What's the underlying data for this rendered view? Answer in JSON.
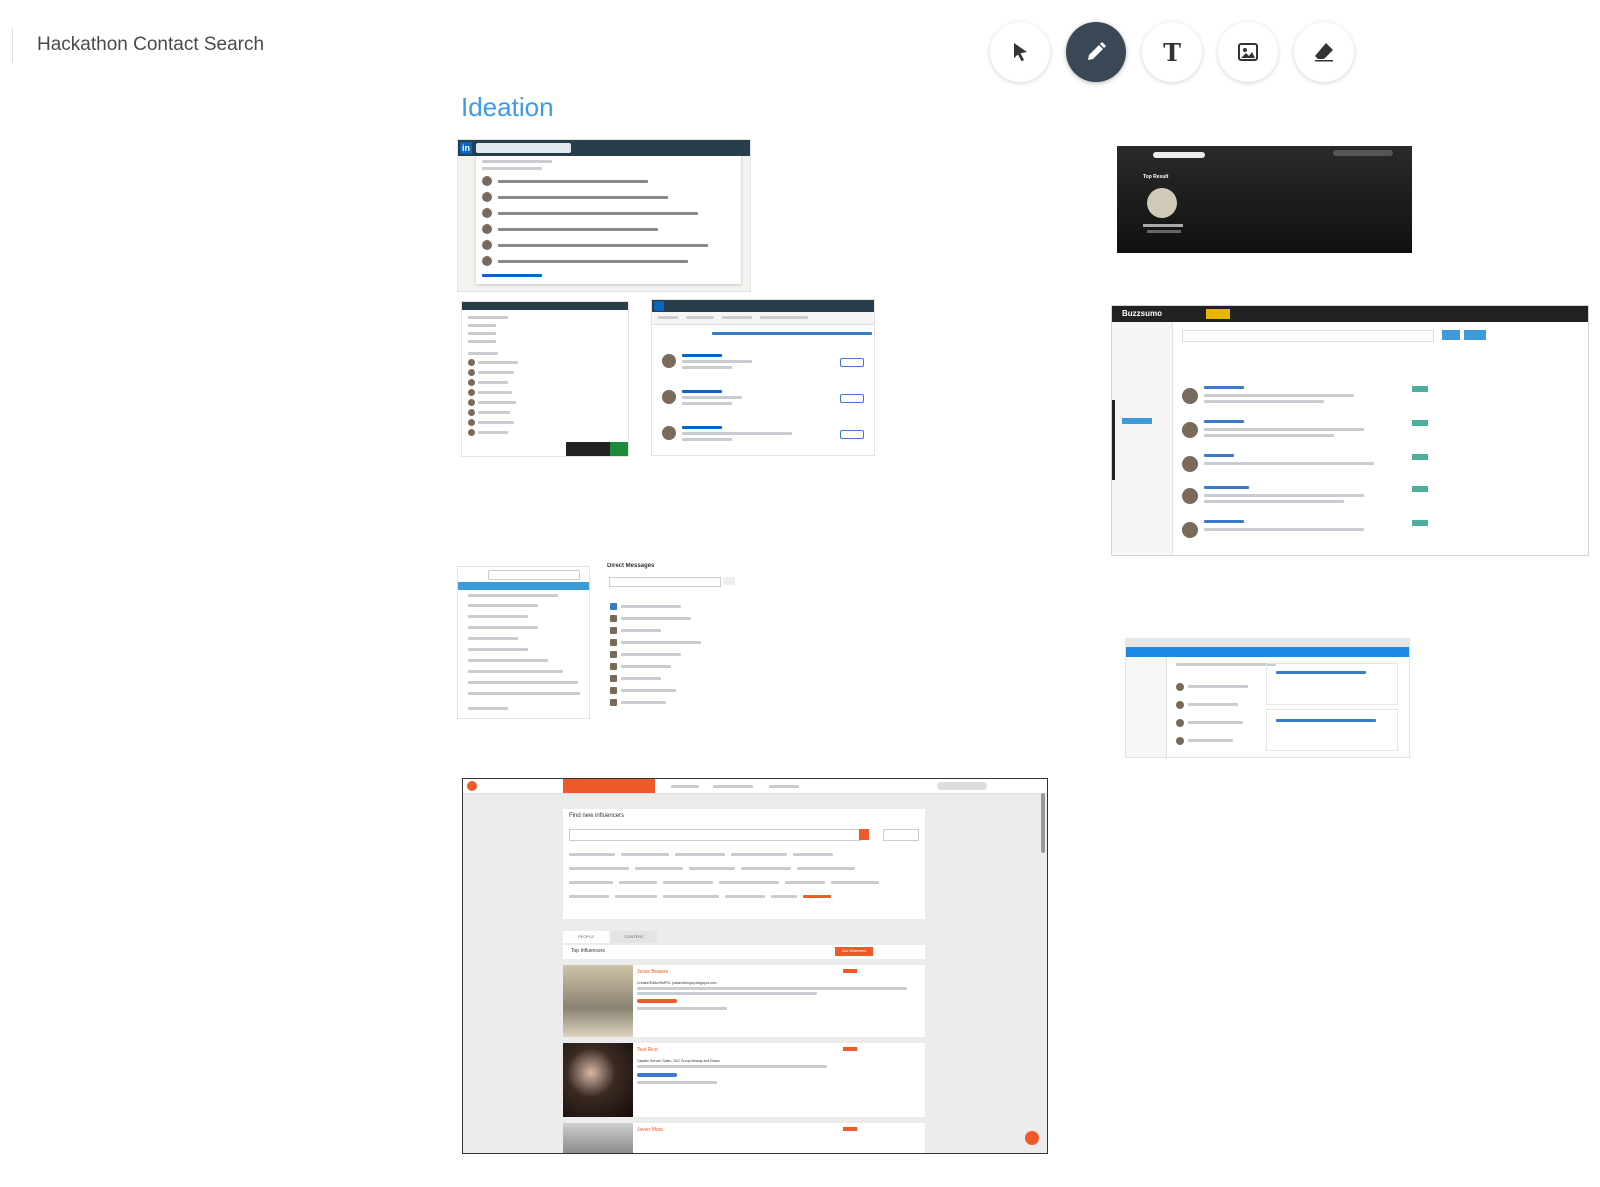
{
  "app": {
    "title": "Hackathon Contact Search"
  },
  "toolbar": {
    "tools": [
      {
        "name": "select-tool",
        "icon": "cursor-arrow-icon",
        "active": false
      },
      {
        "name": "draw-tool",
        "icon": "pencil-icon",
        "active": true
      },
      {
        "name": "text-tool",
        "icon": "text-T-icon",
        "active": false
      },
      {
        "name": "image-tool",
        "icon": "image-icon",
        "active": false
      },
      {
        "name": "eraser-tool",
        "icon": "eraser-icon",
        "active": false
      }
    ],
    "text_glyph": "T"
  },
  "canvas": {
    "heading": "Ideation",
    "linkedin_logo": "in",
    "slack_header": "Direct Messages",
    "spotify_top": "Top Result",
    "buzzsumo_logo": "Buzzsumo",
    "traackr": {
      "find_title": "Find new influencers",
      "tab_people": "PEOPLE",
      "tab_content": "CONTENT",
      "top_influencers": "Top Influencers",
      "add_button": "Add Influencers",
      "people": [
        {
          "name": "Jesse Bowers",
          "headline": "Creator/Editor/HMPIC justanotherguy.blogspot.com"
        },
        {
          "name": "Teal Rice",
          "headline": "Captain Server! Sales, TAG Group Beauty and Essex"
        },
        {
          "name": "Javier Mota",
          "headline": ""
        }
      ]
    },
    "colors": {
      "accent": "#3d9be9",
      "tool_active": "#3a4755",
      "linkedin": "#0a66c2",
      "traackr_orange": "#f05a28"
    }
  }
}
